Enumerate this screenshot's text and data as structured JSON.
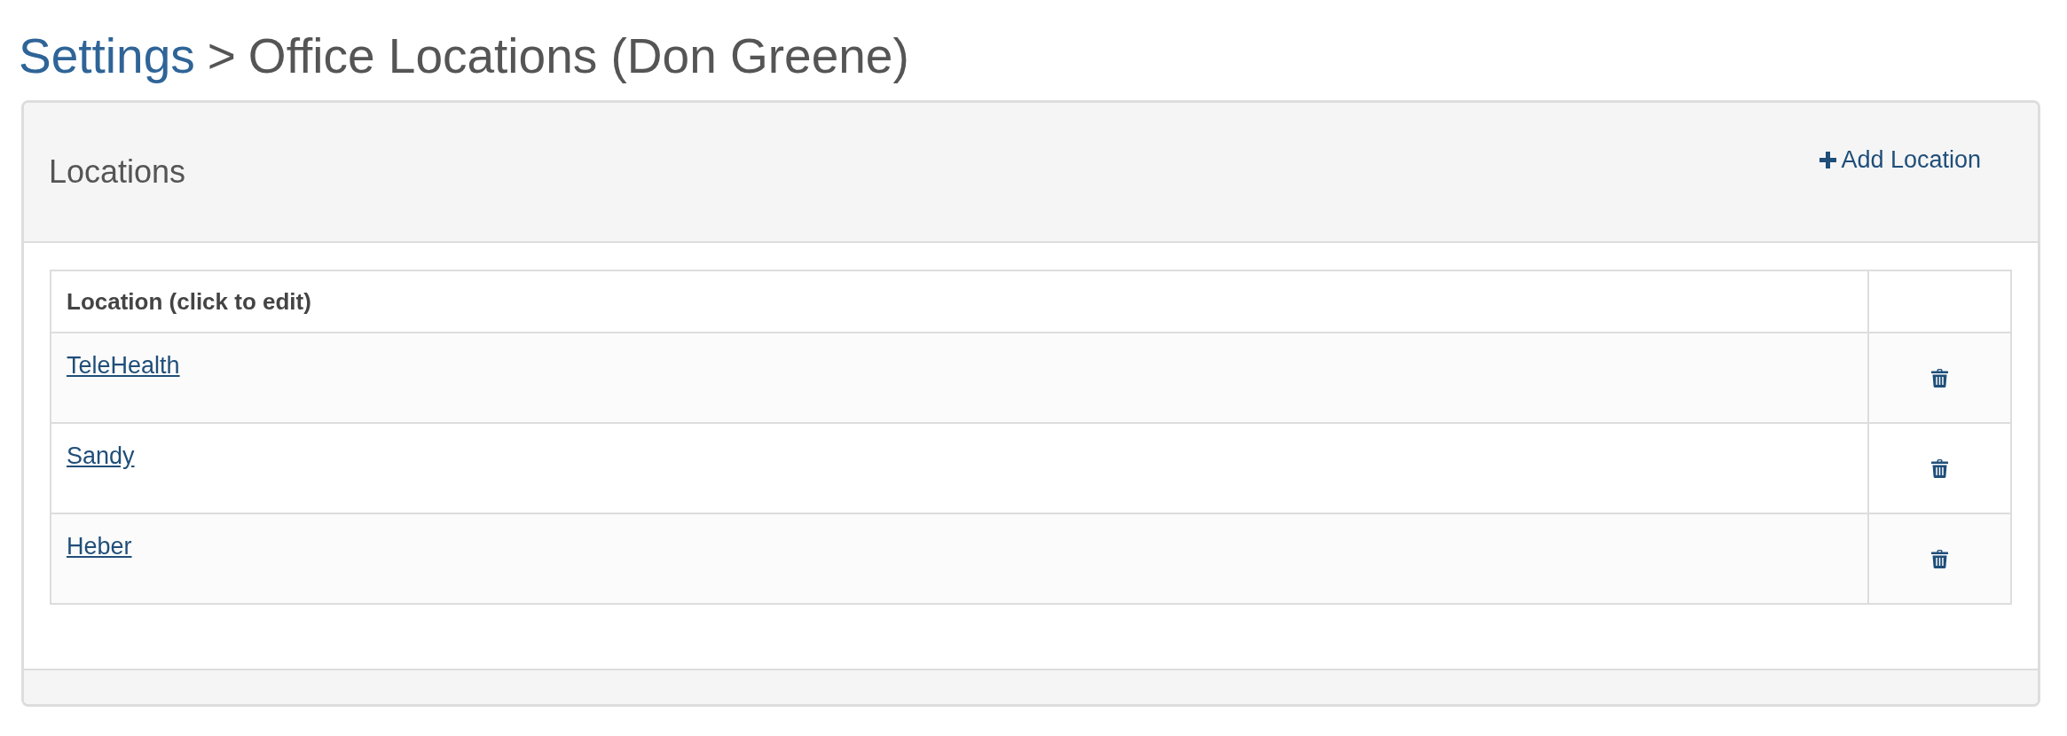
{
  "breadcrumb": {
    "link": "Settings",
    "separator": ">",
    "title": "Office Locations (Don Greene)"
  },
  "panel": {
    "title": "Locations",
    "add_button": "Add Location"
  },
  "table": {
    "columns": [
      "Location (click to edit)"
    ],
    "rows": [
      {
        "location": "TeleHealth"
      },
      {
        "location": "Sandy"
      },
      {
        "location": "Heber"
      }
    ]
  }
}
